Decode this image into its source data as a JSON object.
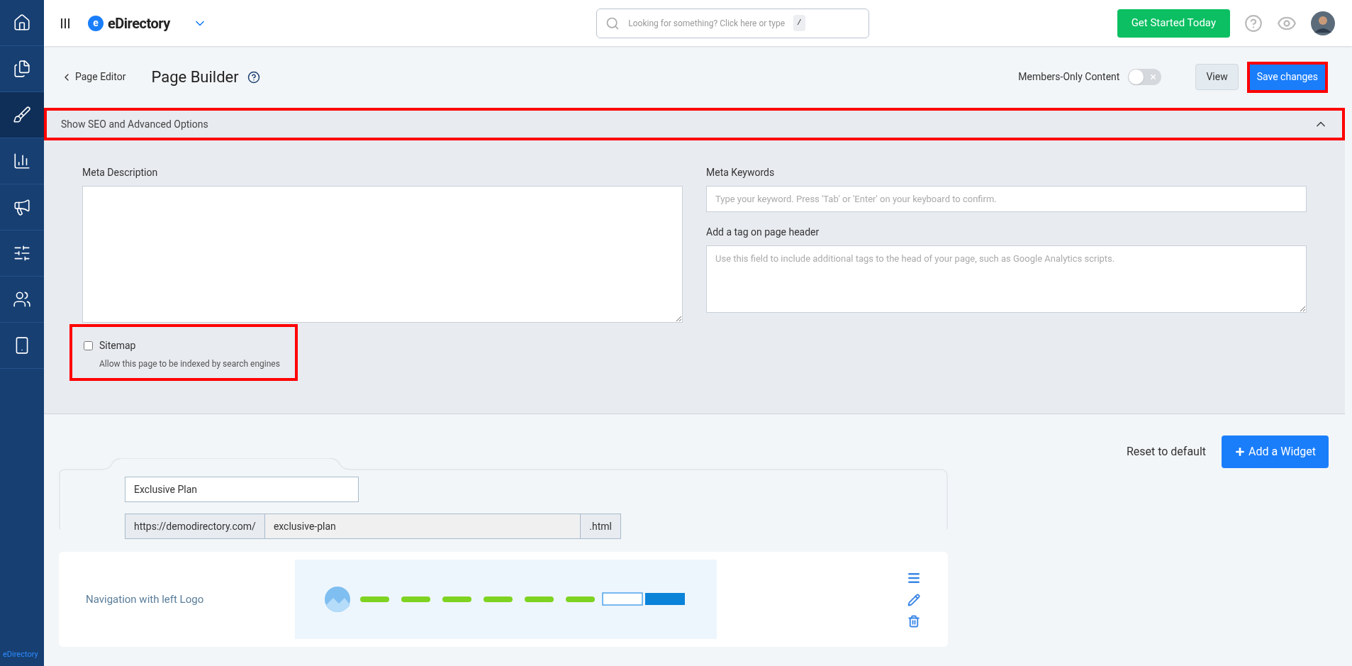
{
  "sidebar": {
    "items": [
      {
        "selected": false
      },
      {
        "selected": false
      },
      {
        "selected": true
      },
      {
        "selected": false
      },
      {
        "selected": false
      },
      {
        "selected": false
      },
      {
        "selected": false
      },
      {
        "selected": false
      }
    ],
    "footer": "eDirectory"
  },
  "topbar": {
    "logo_letter": "e",
    "logo": "eDirectory",
    "search": {
      "placeholder": "Looking for something? Click here or type",
      "shortcut": "/"
    },
    "cta": "Get Started Today"
  },
  "header": {
    "back": "Page Editor",
    "title": "Page Builder",
    "members_only": {
      "label": "Members-Only Content",
      "on": false
    },
    "view": "View",
    "save": {
      "label": "Save changes",
      "highlighted": true
    }
  },
  "seo": {
    "label": "Show SEO and Advanced Options",
    "expanded": true,
    "highlighted": true,
    "meta_description": {
      "label": "Meta Description"
    },
    "meta_keywords": {
      "label": "Meta Keywords",
      "placeholder": "Type your keyword. Press 'Tab' or 'Enter' on your keyboard to confirm."
    },
    "header_tag": {
      "label": "Add a tag on page header",
      "placeholder": "Use this field to include additional tags to the head of your page, such as Google Analytics scripts."
    },
    "sitemap": {
      "label": "Sitemap",
      "hint": "Allow this page to be indexed by search engines",
      "checked": false,
      "highlighted": true
    }
  },
  "actions": {
    "reset": "Reset to default",
    "add": "Add a Widget"
  },
  "page": {
    "title": "Exclusive Plan",
    "url_prefix": "https://demodirectory.com/",
    "slug": "exclusive-plan",
    "url_suffix": ".html"
  },
  "widgets": [
    {
      "name": "Navigation with left Logo"
    }
  ]
}
